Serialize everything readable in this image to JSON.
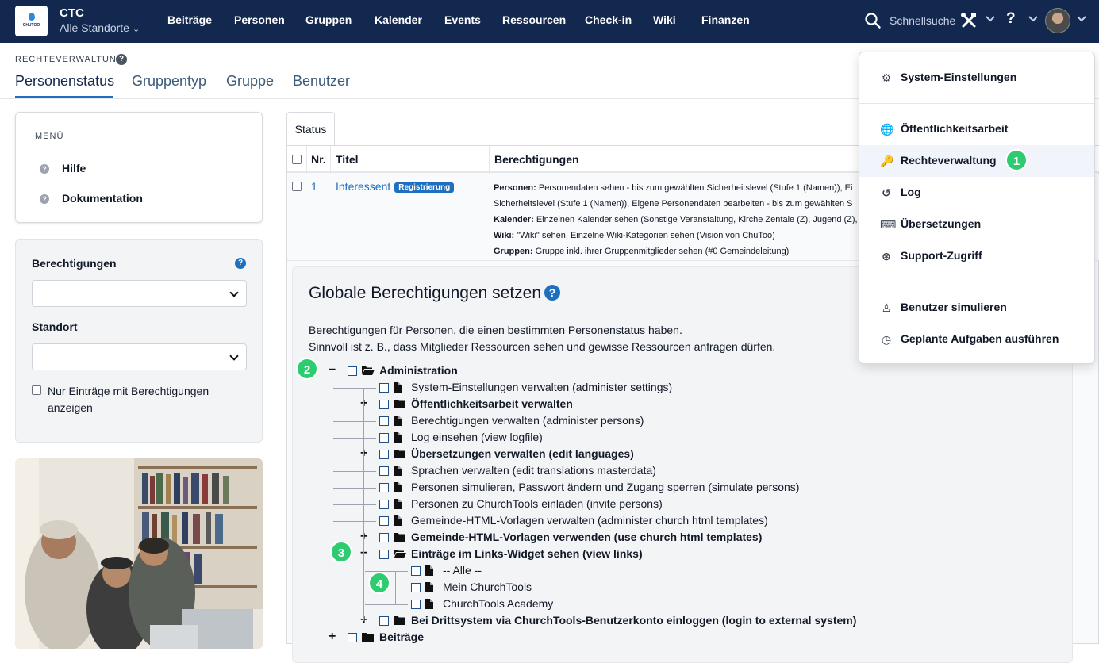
{
  "topbar": {
    "logo_text": "CHUTOO",
    "org_name": "CTC",
    "location_selector": "Alle Standorte",
    "nav": [
      "Beiträge",
      "Personen",
      "Gruppen",
      "Kalender",
      "Events",
      "Ressourcen",
      "Check-in",
      "Wiki",
      "Finanzen"
    ],
    "quick_search": "Schnellsuche",
    "help": "?"
  },
  "header": {
    "section_label": "RECHTEVERWALTUNG",
    "help": "?",
    "tabs": [
      "Personenstatus",
      "Gruppentyp",
      "Gruppe",
      "Benutzer"
    ],
    "active_tab": "Personenstatus"
  },
  "sidebar": {
    "menu_title": "MENÜ",
    "menu_items": [
      "Hilfe",
      "Dokumentation"
    ],
    "filter": {
      "permissions_label": "Berechtigungen",
      "help": "?",
      "location_label": "Standort",
      "only_with_permissions": "Nur Einträge mit Berechtigungen anzeigen"
    }
  },
  "main": {
    "status_tab": "Status",
    "table": {
      "headers": [
        "Nr.",
        "Titel",
        "Berechtigungen"
      ],
      "row": {
        "nr": "1",
        "title": "Interessent",
        "badge": "Registrierung",
        "permissions": [
          {
            "label": "Personen:",
            "text": "Personendaten sehen - bis zum gewählten Sicherheitslevel (Stufe 1 (Namen)), Ei"
          },
          {
            "label": "",
            "text": "Sicherheitslevel (Stufe 1 (Namen)), Eigene Personendaten bearbeiten - bis zum gewählten S"
          },
          {
            "label": "Kalender:",
            "text": "Einzelnen Kalender sehen (Sonstige Veranstaltung, Kirche Zentale (Z), Jugend (Z), K"
          },
          {
            "label": "Wiki:",
            "text": "\"Wiki\" sehen, Einzelne Wiki-Kategorien sehen (Vision von ChuToo)"
          },
          {
            "label": "Gruppen:",
            "text": "Gruppe inkl. ihrer Gruppenmitglieder sehen (#0 Gemeindeleitung)"
          }
        ]
      }
    },
    "global": {
      "title": "Globale Berechtigungen setzen",
      "help": "?",
      "desc_line1": "Berechtigungen für Personen, die einen bestimmten Personenstatus haben.",
      "desc_line2": "Sinnvoll ist z. B., dass Mitglieder Ressourcen sehen und gewisse Ressourcen anfragen dürfen.",
      "tree": [
        {
          "label": "Administration",
          "level": 0,
          "type": "folder-open",
          "bold": true,
          "toggle": "−"
        },
        {
          "label": "System-Einstellungen verwalten (administer settings)",
          "level": 1,
          "type": "file",
          "bold": false,
          "toggle": ""
        },
        {
          "label": "Öffentlichkeitsarbeit verwalten",
          "level": 1,
          "type": "folder",
          "bold": true,
          "toggle": "+"
        },
        {
          "label": "Berechtigungen verwalten (administer persons)",
          "level": 1,
          "type": "file",
          "bold": false,
          "toggle": ""
        },
        {
          "label": "Log einsehen (view logfile)",
          "level": 1,
          "type": "file",
          "bold": false,
          "toggle": ""
        },
        {
          "label": "Übersetzungen verwalten (edit languages)",
          "level": 1,
          "type": "folder",
          "bold": true,
          "toggle": "+"
        },
        {
          "label": "Sprachen verwalten (edit translations masterdata)",
          "level": 1,
          "type": "file",
          "bold": false,
          "toggle": ""
        },
        {
          "label": "Personen simulieren, Passwort ändern und Zugang sperren (simulate persons)",
          "level": 1,
          "type": "file",
          "bold": false,
          "toggle": ""
        },
        {
          "label": "Personen zu ChurchTools einladen (invite persons)",
          "level": 1,
          "type": "file",
          "bold": false,
          "toggle": ""
        },
        {
          "label": "Gemeinde-HTML-Vorlagen verwalten (administer church html templates)",
          "level": 1,
          "type": "file",
          "bold": false,
          "toggle": ""
        },
        {
          "label": "Gemeinde-HTML-Vorlagen verwenden (use church html templates)",
          "level": 1,
          "type": "folder",
          "bold": true,
          "toggle": "+"
        },
        {
          "label": "Einträge im Links-Widget sehen (view links)",
          "level": 1,
          "type": "folder-open",
          "bold": true,
          "toggle": "−"
        },
        {
          "label": "-- Alle --",
          "level": 2,
          "type": "file",
          "bold": false,
          "toggle": ""
        },
        {
          "label": "Mein ChurchTools",
          "level": 2,
          "type": "file",
          "bold": false,
          "toggle": ""
        },
        {
          "label": "ChurchTools Academy",
          "level": 2,
          "type": "file",
          "bold": false,
          "toggle": ""
        },
        {
          "label": "Bei Drittsystem via ChurchTools-Benutzerkonto einloggen (login to external system)",
          "level": 1,
          "type": "folder",
          "bold": true,
          "toggle": "+"
        },
        {
          "label": "Beiträge",
          "level": 0,
          "type": "folder",
          "bold": true,
          "toggle": "+"
        }
      ]
    }
  },
  "dropdown": {
    "groups": [
      [
        {
          "label": "System-Einstellungen",
          "icon": "gear-icon"
        }
      ],
      [
        {
          "label": "Öffentlichkeitsarbeit",
          "icon": "globe-icon"
        },
        {
          "label": "Rechteverwaltung",
          "icon": "key-icon",
          "highlighted": true
        },
        {
          "label": "Log",
          "icon": "history-icon"
        },
        {
          "label": "Übersetzungen",
          "icon": "translate-icon"
        },
        {
          "label": "Support-Zugriff",
          "icon": "lifebuoy-icon"
        }
      ],
      [
        {
          "label": "Benutzer simulieren",
          "icon": "user-secret-icon"
        },
        {
          "label": "Geplante Aufgaben ausführen",
          "icon": "clock-icon"
        }
      ]
    ]
  },
  "markers": [
    "1",
    "2",
    "3",
    "4"
  ],
  "colors": {
    "nav_bg": "#13284f",
    "accent": "#1f6fbf",
    "marker": "#2ecc71"
  }
}
